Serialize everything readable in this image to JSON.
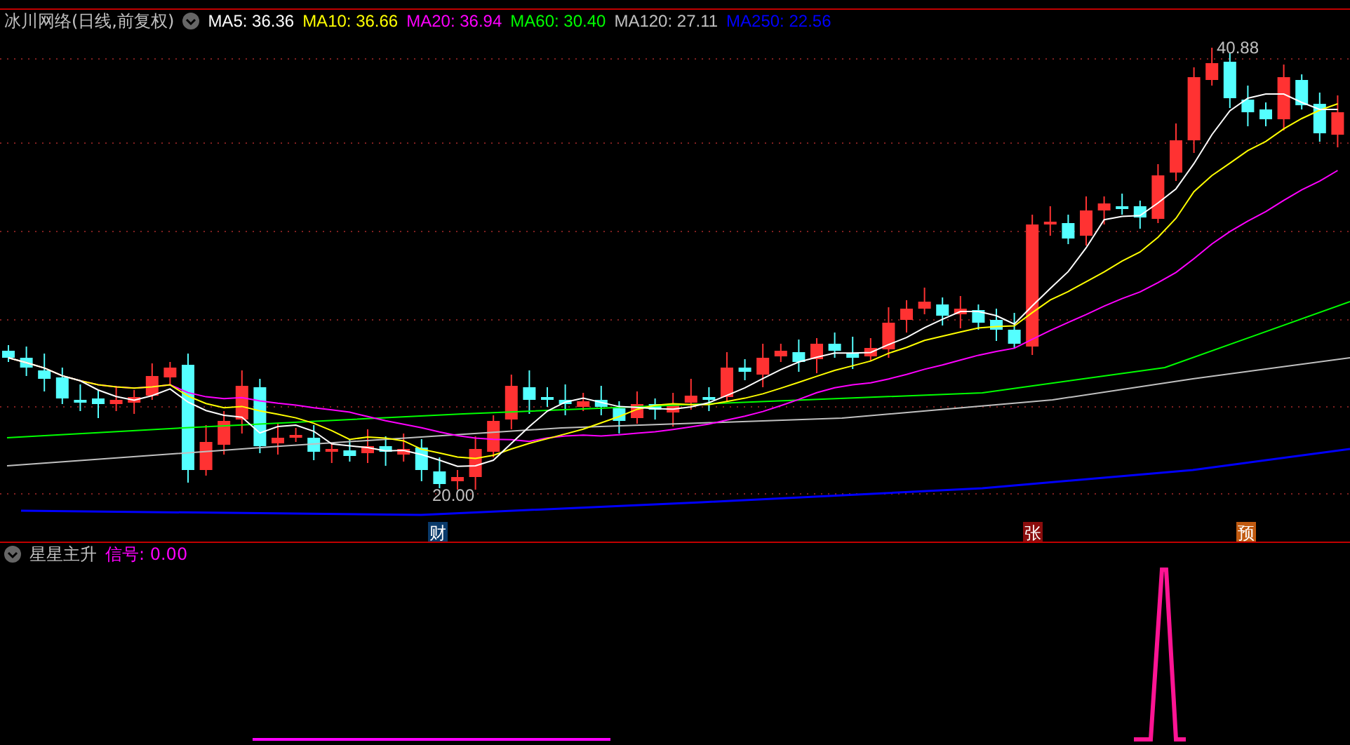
{
  "chart_header": {
    "title": "冰川网络(日线,前复权)",
    "ma_values": [
      {
        "label": "MA5: 36.36",
        "color": "#ffffff"
      },
      {
        "label": "MA10: 36.66",
        "color": "#ffff00"
      },
      {
        "label": "MA20: 36.94",
        "color": "#ff00ff"
      },
      {
        "label": "MA60: 30.40",
        "color": "#00ff00"
      },
      {
        "label": "MA120: 27.11",
        "color": "#c0c0c0"
      },
      {
        "label": "MA250: 22.56",
        "color": "#0000ff"
      }
    ]
  },
  "price_labels": {
    "high": "40.88",
    "low": "20.00"
  },
  "event_markers": [
    {
      "label": "财",
      "color": "#0a3a6a"
    },
    {
      "label": "张",
      "color": "#8a0c0c"
    },
    {
      "label": "预",
      "color": "#c05a10"
    }
  ],
  "indicator_header": {
    "title": "星星主升",
    "signal": "信号: 0.00"
  }
}
